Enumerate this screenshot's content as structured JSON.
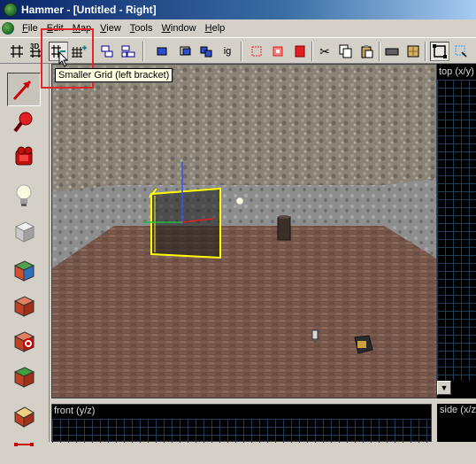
{
  "window": {
    "title": "Hammer - [Untitled - Right]"
  },
  "menu": {
    "items": [
      {
        "label": "File",
        "hotkey": "F",
        "rest": "ile"
      },
      {
        "label": "Edit",
        "hotkey": "E",
        "rest": "dit"
      },
      {
        "label": "Map",
        "hotkey": "M",
        "rest": "ap"
      },
      {
        "label": "View",
        "hotkey": "V",
        "rest": "iew"
      },
      {
        "label": "Tools",
        "hotkey": "T",
        "rest": "ools"
      },
      {
        "label": "Window",
        "hotkey": "W",
        "rest": "indow"
      },
      {
        "label": "Help",
        "hotkey": "H",
        "rest": "elp"
      }
    ]
  },
  "toolbar": {
    "grid_3d_label": "3D",
    "smaller_grid_tooltip": "Smaller Grid (left bracket)",
    "ignore_groups_label": "ig"
  },
  "viewports": {
    "top_label": "top (x/y)",
    "front_label": "front (y/z)",
    "side_label": "side (x/z)"
  },
  "colors": {
    "highlight": "#e0262a",
    "title_bar": "#0a246a",
    "grid_line": "#1e3c5a",
    "selection": "#ffff00"
  },
  "icons": {
    "selection_tool": "pointer-arrow-icon",
    "magnify_tool": "magnify-icon",
    "camera_tool": "camera-icon",
    "entity_tool": "light-bulb-icon",
    "block_tool": "block-icon",
    "texture_app_tool": "texture-cube-icon",
    "apply_decals_tool": "decal-icon",
    "overlay_tool": "overlay-icon",
    "clip_tool": "clip-icon",
    "vertex_tool": "vertex-icon"
  }
}
